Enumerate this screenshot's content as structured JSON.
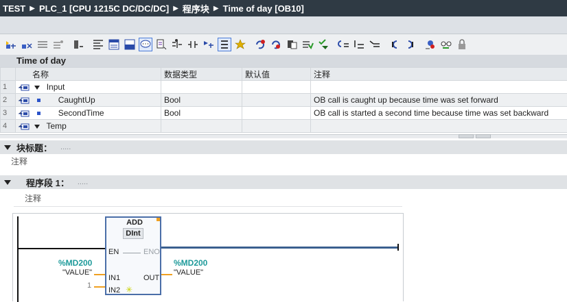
{
  "breadcrumb": [
    "TEST",
    "PLC_1 [CPU 1215C DC/DC/DC]",
    "程序块",
    "Time of day [OB10]"
  ],
  "toolbar": {
    "icons": [
      "insert-network-icon",
      "delete-network-icon",
      "open-all-networks-icon",
      "close-all-networks-icon",
      "show-status-icon",
      "toggle-lines-icon",
      "toggle-blocks-icon",
      "toggle-favorites-icon",
      "show-comments-icon",
      "insert-empty-box-icon",
      "open-branch-icon",
      "insert-contact-icon",
      "go-to-next-error-icon",
      "absolute-addresses-icon",
      "symbolic-addresses-icon",
      "callbook-icon",
      "monitor-icon",
      "monitor-off-icon",
      "compare-icon",
      "check-icon",
      "indent-icon",
      "outdent-icon",
      "branch-open-icon",
      "branch-close-icon",
      "download-icon",
      "monitoring-glasses-icon",
      "lock-icon"
    ]
  },
  "interface": {
    "title": "Time of day",
    "columns": [
      "名称",
      "数据类型",
      "默认值",
      "注释"
    ],
    "rows": [
      {
        "num": "1",
        "name": "Input",
        "type": "",
        "default": "",
        "comment": ""
      },
      {
        "num": "2",
        "name": "CaughtUp",
        "type": "Bool",
        "default": "",
        "comment": "OB call is caught up because time was set forward"
      },
      {
        "num": "3",
        "name": "SecondTime",
        "type": "Bool",
        "default": "",
        "comment": "OB call is started a second time because time was set backward"
      },
      {
        "num": "4",
        "name": "Temp",
        "type": "",
        "default": "",
        "comment": ""
      }
    ]
  },
  "block": {
    "title_label": "块标题：",
    "title_placeholder": ".....",
    "comment": "注释"
  },
  "network": {
    "label": "程序段 1：",
    "title_placeholder": ".....",
    "comment": "注释",
    "box": {
      "instruction": "ADD",
      "type": "DInt",
      "en": "EN",
      "eno": "ENO",
      "in1": "IN1",
      "in2": "IN2",
      "out": "OUT",
      "in1_addr": "%MD200",
      "in1_tag": "\"VALUE\"",
      "in2_value": "1",
      "out_addr": "%MD200",
      "out_tag": "\"VALUE\""
    }
  },
  "colors": {
    "titlebar": "#2f3a44",
    "address": "#1e9a9a",
    "wire_orange": "#f0a020",
    "box_border": "#4a6ea8"
  }
}
